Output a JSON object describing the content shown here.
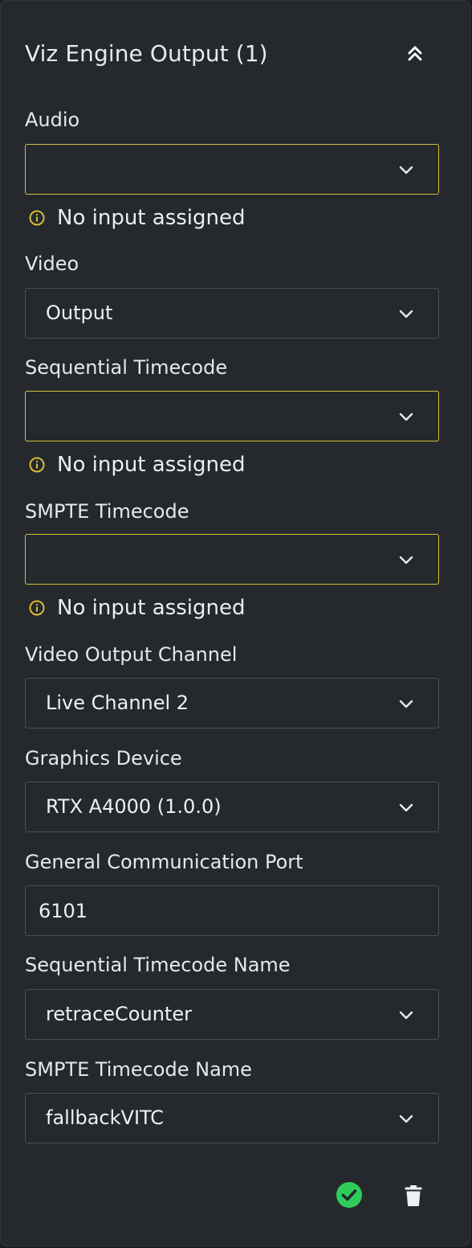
{
  "panel": {
    "title": "Viz Engine Output (1)",
    "collapse_icon": "double-chevron-up-icon"
  },
  "fields": {
    "audio": {
      "label": "Audio",
      "value": "",
      "hint": "No input assigned",
      "status": "warning"
    },
    "video": {
      "label": "Video",
      "value": "Output"
    },
    "sequential_timecode": {
      "label": "Sequential Timecode",
      "value": "",
      "hint": "No input assigned",
      "status": "warning"
    },
    "smpte_timecode": {
      "label": "SMPTE Timecode",
      "value": "",
      "hint": "No input assigned",
      "status": "warning"
    },
    "video_output_channel": {
      "label": "Video Output Channel",
      "value": "Live Channel 2"
    },
    "graphics_device": {
      "label": "Graphics Device",
      "value": "RTX A4000 (1.0.0)"
    },
    "general_communication_port": {
      "label": "General Communication Port",
      "value": "6101"
    },
    "sequential_timecode_name": {
      "label": "Sequential Timecode Name",
      "value": "retraceCounter"
    },
    "smpte_timecode_name": {
      "label": "SMPTE Timecode Name",
      "value": "fallbackVITC"
    }
  },
  "actions": {
    "confirm_icon": "check-circle-icon",
    "delete_icon": "trash-icon"
  },
  "colors": {
    "panel_bg": "#25292d",
    "warning": "#d8bd38",
    "success": "#2ecc5b",
    "border": "#4a4f55",
    "text": "#e6e8ea"
  }
}
